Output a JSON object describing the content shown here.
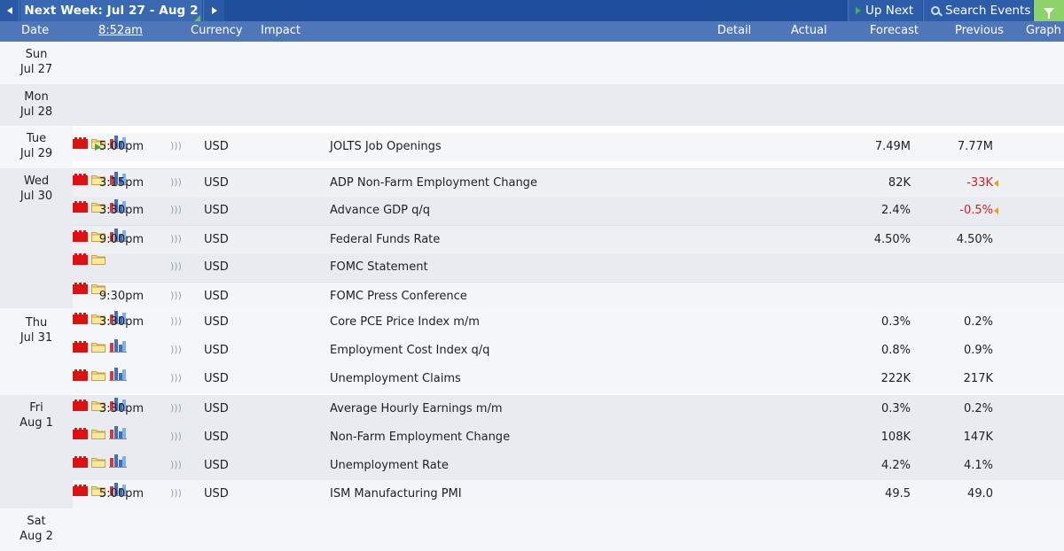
{
  "toolbar": {
    "week_label": "Next Week: Jul 27 - Aug 2",
    "up_next_label": "Up Next",
    "search_label": "Search Events"
  },
  "header": {
    "date": "Date",
    "time": "8:52am",
    "currency": "Currency",
    "impact": "Impact",
    "detail": "Detail",
    "actual": "Actual",
    "forecast": "Forecast",
    "previous": "Previous",
    "graph": "Graph"
  },
  "days": [
    {
      "dow": "Sun",
      "date": "Jul 27"
    },
    {
      "dow": "Mon",
      "date": "Jul 28"
    },
    {
      "dow": "Tue",
      "date": "Jul 29"
    },
    {
      "dow": "Wed",
      "date": "Jul 30"
    },
    {
      "dow": "Thu",
      "date": "Jul 31"
    },
    {
      "dow": "Fri",
      "date": "Aug 1"
    },
    {
      "dow": "Sat",
      "date": "Aug 2"
    }
  ],
  "events": [
    {
      "time": "5:00pm",
      "currency": "USD",
      "event": "JOLTS Job Openings",
      "forecast": "7.49M",
      "previous": "7.77M"
    },
    {
      "time": "3:15pm",
      "currency": "USD",
      "event": "ADP Non-Farm Employment Change",
      "forecast": "82K",
      "previous": "-33K"
    },
    {
      "time": "3:30pm",
      "currency": "USD",
      "event": "Advance GDP q/q",
      "forecast": "2.4%",
      "previous": "-0.5%"
    },
    {
      "time": "9:00pm",
      "currency": "USD",
      "event": "Federal Funds Rate",
      "forecast": "4.50%",
      "previous": "4.50%"
    },
    {
      "time": "",
      "currency": "USD",
      "event": "FOMC Statement",
      "forecast": "",
      "previous": ""
    },
    {
      "time": "9:30pm",
      "currency": "USD",
      "event": "FOMC Press Conference",
      "forecast": "",
      "previous": ""
    },
    {
      "time": "3:30pm",
      "currency": "USD",
      "event": "Core PCE Price Index m/m",
      "forecast": "0.3%",
      "previous": "0.2%"
    },
    {
      "time": "",
      "currency": "USD",
      "event": "Employment Cost Index q/q",
      "forecast": "0.8%",
      "previous": "0.9%"
    },
    {
      "time": "",
      "currency": "USD",
      "event": "Unemployment Claims",
      "forecast": "222K",
      "previous": "217K"
    },
    {
      "time": "3:30pm",
      "currency": "USD",
      "event": "Average Hourly Earnings m/m",
      "forecast": "0.3%",
      "previous": "0.2%"
    },
    {
      "time": "",
      "currency": "USD",
      "event": "Non-Farm Employment Change",
      "forecast": "108K",
      "previous": "147K"
    },
    {
      "time": "",
      "currency": "USD",
      "event": "Unemployment Rate",
      "forecast": "4.2%",
      "previous": "4.1%"
    },
    {
      "time": "5:00pm",
      "currency": "USD",
      "event": "ISM Manufacturing PMI",
      "forecast": "49.5",
      "previous": "49.0"
    }
  ],
  "colors": {
    "toolbar": "#1f4f9b",
    "header": "#4f76b9",
    "impact_high": "#e01010",
    "negative": "#d02020",
    "filter": "#8ed26a"
  }
}
